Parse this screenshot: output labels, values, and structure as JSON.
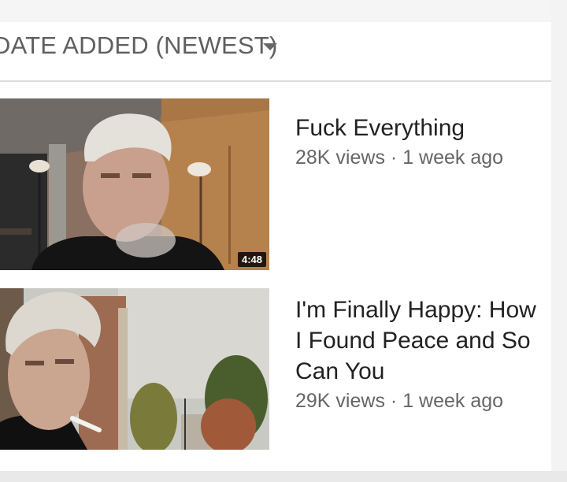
{
  "sort": {
    "label": "DATE ADDED (NEWEST)",
    "caret_icon": "chevron-down-icon"
  },
  "videos": [
    {
      "title": "Fuck Everything",
      "views": "28K views",
      "separator": "·",
      "age": "1 week ago",
      "duration": "4:48"
    },
    {
      "title": "I'm Finally Happy: How I Found Peace and So Can You",
      "views": "29K views",
      "separator": "·",
      "age": "1 week ago"
    }
  ],
  "colors": {
    "text_primary": "#222222",
    "text_secondary": "#666666",
    "divider": "#dcdcdc",
    "background": "#ffffff"
  }
}
